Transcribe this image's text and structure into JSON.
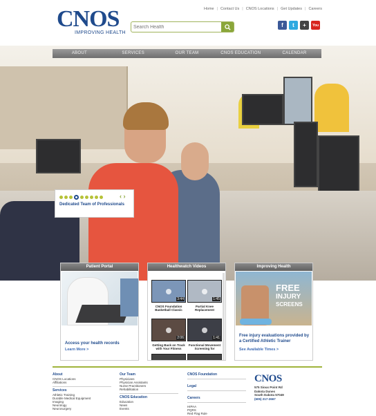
{
  "header": {
    "logo_main": "CNOS",
    "logo_tagline": "IMPROVING HEALTH",
    "top_links": [
      "Home",
      "Contact Us",
      "CNOS Locations",
      "Get Updates",
      "Careers"
    ],
    "search_placeholder": "Search Health",
    "social": [
      {
        "name": "facebook-icon",
        "glyph": "f",
        "color": "#3b5998"
      },
      {
        "name": "twitter-icon",
        "glyph": "t",
        "color": "#2fa9e0"
      },
      {
        "name": "google-plus-icon",
        "glyph": "+",
        "color": "#444444"
      },
      {
        "name": "youtube-icon",
        "glyph": "You",
        "color": "#d8251d"
      }
    ]
  },
  "nav": [
    "ABOUT",
    "SERVICES",
    "OUR TEAM",
    "CNOS EDUCATION",
    "CALENDAR"
  ],
  "slider": {
    "caption": "Dedicated Team of Professionals",
    "slide_count": 9,
    "active_slide": 4,
    "arrows": "‹ ›"
  },
  "panels": {
    "portal": {
      "title": "Patient Portal",
      "text": "Access your health records",
      "more": "Learn More >"
    },
    "videos": {
      "title": "Healthwatch Videos",
      "items": [
        {
          "caption": "CNOS Foundation Basketball Classic",
          "time": "3:44"
        },
        {
          "caption": "Partial Knee Replacement",
          "time": "1:45"
        },
        {
          "caption": "Getting Back on Track with Your Fitness",
          "time": "2:06"
        },
        {
          "caption": "Functional Movement Screening for",
          "time": "1:41"
        }
      ]
    },
    "improving": {
      "title": "Improving Health",
      "overlay1": "FREE",
      "overlay2": "INJURY",
      "overlay3": "SCREENS",
      "text": "Free injury evaluations provided by a Certified Athletic Trainer",
      "more": "See Available Times >"
    }
  },
  "footer": {
    "about": {
      "heading": "About",
      "items": [
        "CNOS Locations",
        "Affiliations"
      ]
    },
    "services": {
      "heading": "Services",
      "items": [
        "Athletic Training",
        "Durable Medical Equipment",
        "Imaging",
        "Neurology",
        "Neurosurgery"
      ]
    },
    "our_team": {
      "heading": "Our Team",
      "items": [
        "Physicians",
        "Physician Assistants",
        "Nurse Practitioners",
        "Rehabilitation"
      ]
    },
    "education": {
      "heading": "CNOS Education",
      "items": [
        "Education",
        "News",
        "Events"
      ]
    },
    "foundation": {
      "heading": "CNOS Foundation"
    },
    "legal": {
      "heading": "Legal"
    },
    "careers": {
      "heading": "Careers",
      "items": [
        "HIPAA",
        "PQRS",
        "Red Flag Rule"
      ]
    },
    "logo": "CNOS",
    "address": [
      "575 Sioux Point Rd",
      "Dakota Dunes",
      "South Dakota 57049"
    ],
    "phone": "(605) 217-2667"
  }
}
